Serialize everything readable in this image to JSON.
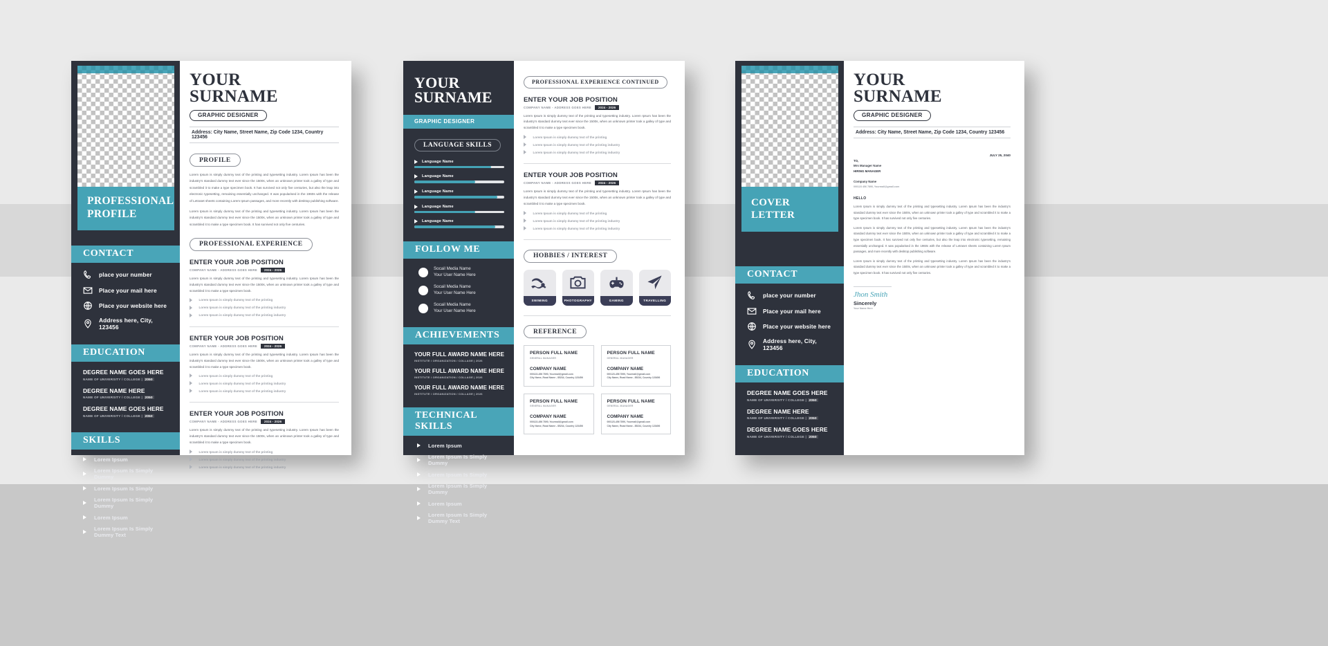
{
  "colors": {
    "teal": "#45a3b6",
    "dark": "#2e323c",
    "light_gray": "#eaeaea",
    "hobby_label": "#3b3e57"
  },
  "common": {
    "name_line1": "YOUR",
    "name_line2": "SURNAME",
    "job_pill": "GRAPHIC DESIGNER",
    "address_line": "Address: City Name, Street Name, Zip Code 1234, Country 123456",
    "lorem_long": "Lorem Ipsum is simply dummy text of the printing and typesetting industry. Lorem Ipsum has been the industry's standard dummy text ever since the 1500s, when an unknown printer took a galley of type and scrambled it to make a type specimen book. It has survived not only five centuries, but also the leap into electronic typesetting, remaining essentially unchanged. It was popularised in the 1960s with the release of Letraset sheets containing Lorem Ipsum passages, and more recently with desktop publishing software.",
    "lorem_short": "Lorem Ipsum is simply dummy text of the printing and typesetting industry. Lorem Ipsum has been the industry's standard dummy text ever since the 1500s, when an unknown printer took a galley of type and scrambled it to make a type specimen book. It has survived not only five centuries.",
    "job_body": "Lorem Ipsum is simply dummy text of the printing and typesetting industry. Lorem Ipsum has been the industry's standard dummy text ever since the 1500s, when an unknown printer took a galley of type and scrambled it to make a type specimen book."
  },
  "page1": {
    "sidebar": {
      "profile_band": "PROFESSIONAL PROFILE",
      "contact_heading": "CONTACT",
      "contact": [
        {
          "icon": "phone-icon",
          "label": "place your number"
        },
        {
          "icon": "mail-icon",
          "label": "Place your mail here"
        },
        {
          "icon": "globe-icon",
          "label": "Place your website here"
        },
        {
          "icon": "location-pin-icon",
          "label": "Address here, City, 123456"
        }
      ],
      "education_heading": "EDUCATION",
      "education": [
        {
          "degree": "DEGREE NAME GOES HERE",
          "school": "NAME OF UNIVERSITY / COLLEGE | ",
          "year": "2050"
        },
        {
          "degree": "DEGREE NAME HERE",
          "school": "NAME OF UNIVERSITY / COLLEGE | ",
          "year": "2050"
        },
        {
          "degree": "DEGREE NAME GOES HERE",
          "school": "NAME OF UNIVERSITY / COLLEGE | ",
          "year": "2050"
        }
      ],
      "skills_heading": "SKILLS",
      "skills": [
        "Lorem Ipsum",
        "Lorem Ipsum Is Simply Dummy",
        "Lorem Ipsum Is Simply",
        "Lorem Ipsum Is Simply Dummy",
        "Lorem Ipsum",
        "Lorem Ipsum Is Simply Dummy Text"
      ]
    },
    "content": {
      "profile_heading": "PROFILE",
      "experience_heading": "PROFESSIONAL EXPERIENCE",
      "jobs": [
        {
          "title": "ENTER YOUR JOB POSITION",
          "sub": "COMPANY NAME - ADDRESS GOES HERE",
          "date": "2024 - 2026",
          "bullets": [
            "Lorem Ipsum is simply dummy text of the printing",
            "Lorem Ipsum is simply dummy text of the printing industry",
            "Lorem Ipsum is simply dummy text of the printing industry"
          ]
        },
        {
          "title": "ENTER YOUR JOB POSITION",
          "sub": "COMPANY NAME - ADDRESS GOES HERE",
          "date": "2024 - 2026",
          "bullets": [
            "Lorem Ipsum is simply dummy text of the printing",
            "Lorem Ipsum is simply dummy text of the printing industry",
            "Lorem Ipsum is simply dummy text of the printing industry"
          ]
        },
        {
          "title": "ENTER YOUR JOB POSITION",
          "sub": "COMPANY NAME - ADDRESS GOES HERE",
          "date": "2024 - 2026",
          "bullets": [
            "Lorem Ipsum is simply dummy text of the printing",
            "Lorem Ipsum is simply dummy text of the printing industry",
            "Lorem Ipsum is simply dummy text of the printing industry"
          ]
        }
      ]
    }
  },
  "page2": {
    "sidebar": {
      "language_heading": "LANGUAGE SKILLS",
      "languages": [
        {
          "label": "Language Name",
          "percent": 85
        },
        {
          "label": "Language Name",
          "percent": 68
        },
        {
          "label": "Language Name",
          "percent": 92
        },
        {
          "label": "Language Name",
          "percent": 68
        },
        {
          "label": "Language Name",
          "percent": 90
        }
      ],
      "follow_heading": "FOLLOW ME",
      "social": [
        {
          "name": "Socail Media Name",
          "user": "Your User Name Here"
        },
        {
          "name": "Socail Media Name",
          "user": "Your User Name Here"
        },
        {
          "name": "Socail Media Name",
          "user": "Your User Name Here"
        }
      ],
      "achievements_heading": "ACHIEVEMENTS",
      "achievements": [
        {
          "title": "YOUR FULL AWARD NAME HERE",
          "sub": "INSTITUTE / ORGANIZATION / COLLAGE | 2026"
        },
        {
          "title": "YOUR FULL AWARD NAME HERE",
          "sub": "INSTITUTE / ORGANIZATION / COLLAGE | 2026"
        },
        {
          "title": "YOUR FULL AWARD NAME HERE",
          "sub": "INSTITUTE / ORGANIZATION / COLLAGE | 2026"
        }
      ],
      "technical_heading": "TECHNICAL SKILLS",
      "technical": [
        "Lorem Ipsum",
        "Lorem Ipsum Is Simply Dummy",
        "Lorem Ipsum Is Simply",
        "Lorem Ipsum Is Simply Dummy",
        "Lorem Ipsum",
        "Lorem Ipsum Is Simply Dummy Text"
      ]
    },
    "content": {
      "continued_heading": "PROFESSIONAL EXPERIENCE CONTINUED",
      "jobs": [
        {
          "title": "ENTER YOUR JOB POSITION",
          "sub": "COMPANY NAME - ADDRESS GOES HERE",
          "date": "2024 - 2026",
          "bullets": [
            "Lorem Ipsum is simply dummy text of the printing",
            "Lorem Ipsum is simply dummy text of the printing industry",
            "Lorem Ipsum is simply dummy text of the printing industry"
          ]
        },
        {
          "title": "ENTER YOUR JOB POSITION",
          "sub": "COMPANY NAME - ADDRESS GOES HERE",
          "date": "2024 - 2026",
          "bullets": [
            "Lorem Ipsum is simply dummy text of the printing",
            "Lorem Ipsum is simply dummy text of the printing industry",
            "Lorem Ipsum is simply dummy text of the printing industry"
          ]
        }
      ],
      "hobbies_heading": "HOBBIES / INTEREST",
      "hobbies": [
        {
          "icon": "swimmer-icon",
          "label": "SWIMING"
        },
        {
          "icon": "camera-icon",
          "label": "PHOTOGRAPHY"
        },
        {
          "icon": "gamepad-icon",
          "label": "GAMING"
        },
        {
          "icon": "paper-plane-icon",
          "label": "TRAVELLING"
        }
      ],
      "reference_heading": "REFERENCE",
      "references": [
        {
          "name": "PERSON FULL NAME",
          "role": "GENERAL MANAGER",
          "company": "COMPANY NAME",
          "phone": "000123-456 7890,",
          "mail": "Yourmail@gmail.com",
          "addr": "City Name, Road Name - 85234, Country 123456"
        },
        {
          "name": "PERSON FULL NAME",
          "role": "GENERAL MANAGER",
          "company": "COMPANY NAME",
          "phone": "000123-456 7890,",
          "mail": "Yourmail@gmail.com",
          "addr": "City Name, Road Name - 85234, Country 123456"
        },
        {
          "name": "PERSON FULL NAME",
          "role": "GENERAL MANAGER",
          "company": "COMPANY NAME",
          "phone": "000123-456 7890,",
          "mail": "Yourmail@gmail.com",
          "addr": "City Name, Road Name - 85234, Country 123456"
        },
        {
          "name": "PERSON FULL NAME",
          "role": "GENERAL MANAGER",
          "company": "COMPANY NAME",
          "phone": "000123-456 7890,",
          "mail": "Yourmail@gmail.com",
          "addr": "City Name, Road Name - 85234, Country 123456"
        }
      ]
    }
  },
  "page3": {
    "sidebar": {
      "cover_band": "COVER LETTER",
      "contact_heading": "CONTACT",
      "contact": [
        {
          "icon": "phone-icon",
          "label": "place your number"
        },
        {
          "icon": "mail-icon",
          "label": "Place your mail here"
        },
        {
          "icon": "globe-icon",
          "label": "Place your website here"
        },
        {
          "icon": "location-pin-icon",
          "label": "Address here, City, 123456"
        }
      ],
      "education_heading": "EDUCATION",
      "education": [
        {
          "degree": "DEGREE NAME GOES HERE",
          "school": "NAME OF UNIVERSITY / COLLEGE | ",
          "year": "2050"
        },
        {
          "degree": "DEGREE NAME HERE",
          "school": "NAME OF UNIVERSITY / COLLEGE | ",
          "year": "2050"
        },
        {
          "degree": "DEGREE NAME GOES HERE",
          "school": "NAME OF UNIVERSITY / COLLEGE | ",
          "year": "2050"
        }
      ]
    },
    "content": {
      "date": "JULY 25, 2040",
      "to_label": "TO,",
      "to_name": "Mrs Manager Name",
      "to_role": "HIRING MANAGER",
      "company_label": "Company Name",
      "company_contact": "000123 456 7890,   Yourmail@gmail.com",
      "hello": "HELLO",
      "sig_word": "Jhon Smith",
      "sincerely": "Sincerely",
      "sig_name": "Your Name Here"
    }
  }
}
